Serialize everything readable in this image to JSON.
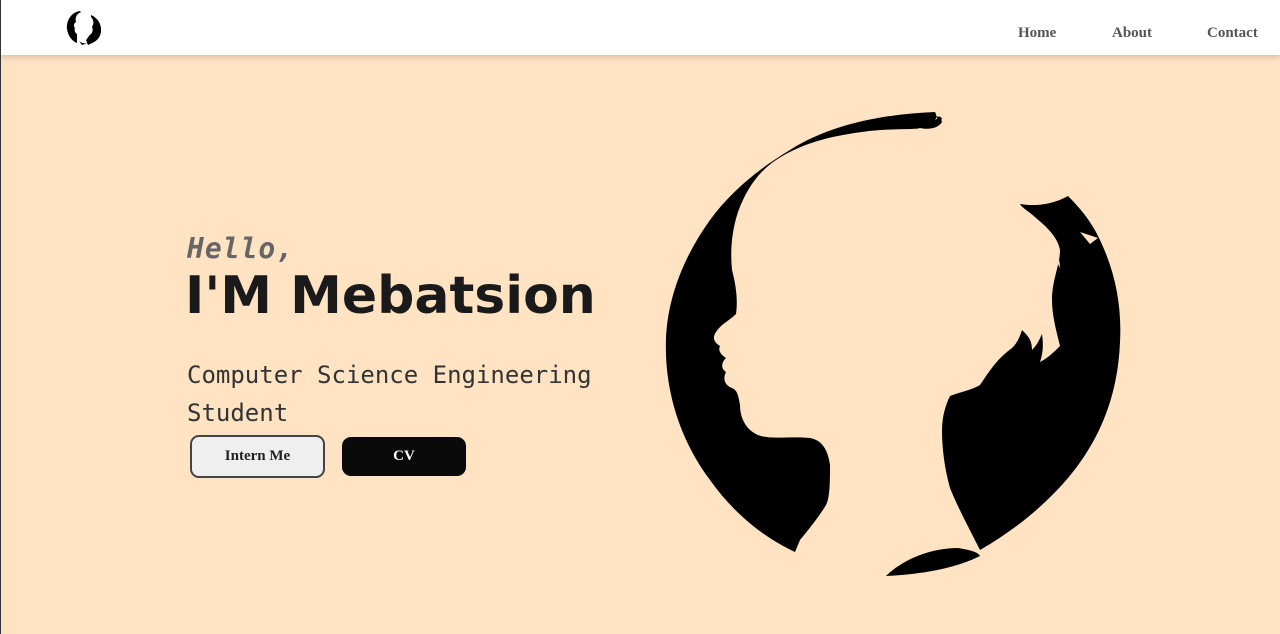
{
  "nav": {
    "links": [
      "Home",
      "About",
      "Contact"
    ]
  },
  "hero": {
    "greeting": "Hello,",
    "name": "I'M Mebatsion",
    "subtitle": "Computer Science Engineering Student",
    "buttons": {
      "intern_label": "Intern Me",
      "cv_label": "CV"
    }
  },
  "icons": {
    "logo": "face-silhouette-logo-icon",
    "hero_art": "face-silhouette-circle-illustration"
  },
  "colors": {
    "background": "#ffe3c3",
    "navbar": "#ffffff",
    "text_dark": "#1a1a1a",
    "cv_button": "#0a0a0a"
  }
}
